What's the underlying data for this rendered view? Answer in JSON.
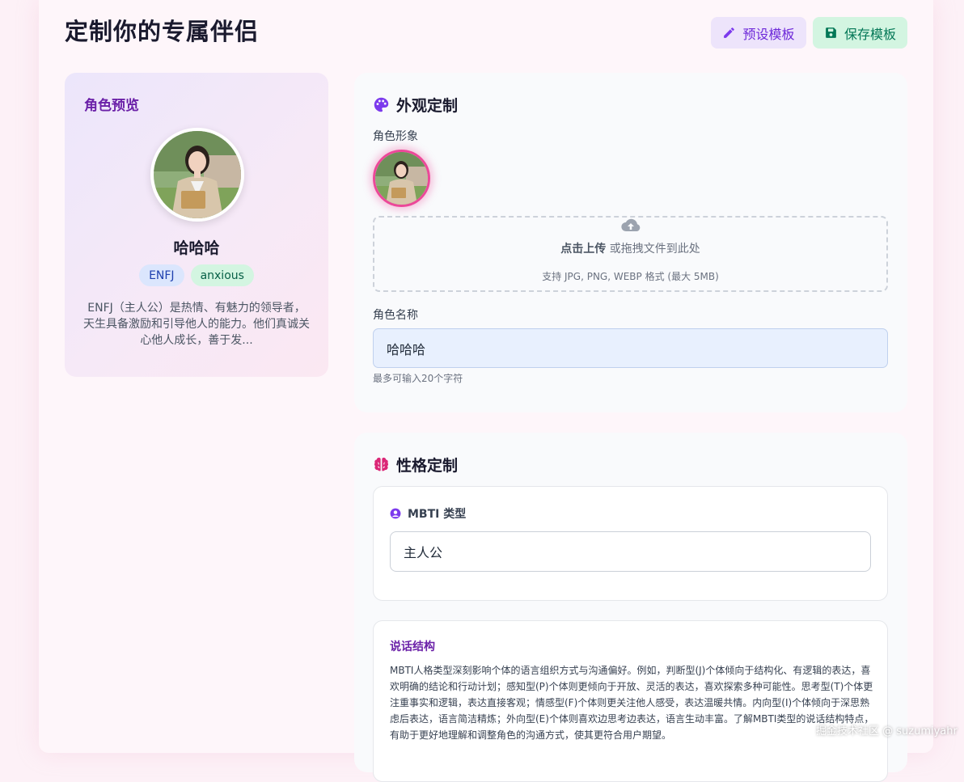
{
  "header": {
    "title": "定制你的专属伴侣",
    "preset_label": "预设模板",
    "save_label": "保存模板"
  },
  "preview": {
    "title": "角色预览",
    "name": "哈哈哈",
    "tags": [
      "ENFJ",
      "anxious"
    ],
    "description": "ENFJ（主人公）是热情、有魅力的领导者，天生具备激励和引导他人的能力。他们真诚关心他人成长，善于发..."
  },
  "appearance": {
    "title": "外观定制",
    "icon": "palette-icon",
    "avatar_label": "角色形象",
    "upload_strong": "点击上传",
    "upload_rest": " 或拖拽文件到此处",
    "upload_hint": "支持 JPG, PNG, WEBP 格式 (最大 5MB)",
    "name_label": "角色名称",
    "name_value": "哈哈哈",
    "name_hint": "最多可输入20个字符"
  },
  "personality": {
    "title": "性格定制",
    "icon": "brain-icon",
    "mbti_label": "MBTI 类型",
    "mbti_value": "主人公",
    "speech_title": "说话结构",
    "speech_body": "MBTI人格类型深刻影响个体的语言组织方式与沟通偏好。例如，判断型(J)个体倾向于结构化、有逻辑的表达，喜欢明确的结论和行动计划；感知型(P)个体则更倾向于开放、灵活的表达，喜欢探索多种可能性。思考型(T)个体更注重事实和逻辑，表达直接客观；情感型(F)个体则更关注他人感受，表达温暖共情。内向型(I)个体倾向于深思熟虑后表达，语言简洁精炼；外向型(E)个体则喜欢边思考边表达，语言生动丰富。了解MBTI类型的说话结构特点，有助于更好地理解和调整角色的沟通方式，使其更符合用户期望。"
  },
  "watermark": "掘金技术社区 @ suzumiyahr",
  "colors": {
    "accent_purple": "#6b21a8",
    "accent_pink": "#ec4899",
    "save_green": "#047857"
  }
}
